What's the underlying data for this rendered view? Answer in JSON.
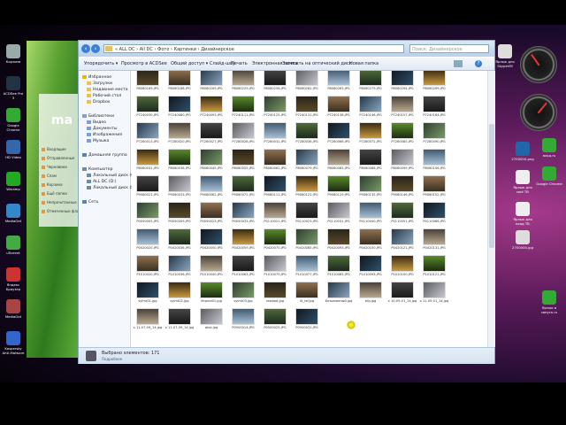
{
  "explorer": {
    "address": "« ALL DC › All DC › Фото › Картинки › Дизайнерское",
    "search_placeholder": "Поиск: Дизайнерское",
    "toolbar": [
      "Упорядочить ▾",
      "Просмотр в ACDSee",
      "Общий доступ ▾",
      "Слайд-шоу",
      "Печать",
      "Электронная почта",
      "Записать на оптический диск",
      "Новая папка"
    ],
    "nav": [
      {
        "label": "Избранное",
        "icon": "star-icon"
      },
      {
        "label": "Загрузки",
        "icon": "folder-icon"
      },
      {
        "label": "Недавние места",
        "icon": "folder-icon"
      },
      {
        "label": "Рабочий стол",
        "icon": "folder-icon"
      },
      {
        "label": "Dropbox",
        "icon": "folder-icon"
      },
      {
        "label": "Библиотеки",
        "icon": "library-icon"
      },
      {
        "label": "Видео",
        "icon": "library-icon"
      },
      {
        "label": "Документы",
        "icon": "library-icon"
      },
      {
        "label": "Изображения",
        "icon": "library-icon"
      },
      {
        "label": "Музыка",
        "icon": "library-icon"
      },
      {
        "label": "Домашняя группа",
        "icon": "network-icon"
      },
      {
        "label": "Компьютер",
        "icon": "computer-icon"
      },
      {
        "label": "Локальный диск (C:)",
        "icon": "computer-icon"
      },
      {
        "label": "ALL DC (D:)",
        "icon": "computer-icon"
      },
      {
        "label": "Локальный диск (E:)",
        "icon": "computer-icon"
      },
      {
        "label": "Сеть",
        "icon": "network-icon"
      }
    ],
    "status_text": "Выбрано элементов: 171",
    "status_sub": "Подробнее"
  },
  "thumbnails": [
    "P8080169.JPG",
    "P8080188.JPG",
    "P8080209.JPG",
    "P8080229.JPG",
    "P8080256.JPG",
    "P8080262.JPG",
    "P8080263.JPG",
    "P8080279.JPG",
    "P8080294.JPG",
    "P8080299.JPG",
    "P7240030.JPG",
    "P7240080.JPG",
    "P7240093.JPG",
    "P7240111.JPG",
    "P7240125.JPG",
    "P7240131.JPG",
    "P7240138.JPG",
    "P7240146.JPG",
    "P7240157.JPG",
    "P7240164.JPG",
    "P7280013.JPG",
    "P7280020.JPG",
    "P7280027.JPG",
    "P7280028.JPG",
    "P7280031.JPG",
    "P7280036.JPG",
    "P7280066.JPG",
    "P7280072.JPG",
    "P7280085.JPG",
    "P7280090.JPG",
    "P8080031.JPG",
    "P8080038.JPG",
    "P8080045.JPG",
    "P8080055.JPG",
    "P8080062.JPG",
    "P8080079.JPG",
    "P8080085.JPG",
    "P8080088.JPG",
    "P8080099.JPG",
    "P8080106.JPG",
    "P9080021.JPG",
    "P9080033.JPG",
    "P9080062.JPG",
    "P9080072.JPG",
    "P9080111.JPG",
    "P9080121.JPG",
    "P9080129.JPG",
    "P9080135.JPG",
    "P9080146.JPG",
    "P9080152.JPG",
    "P0050005.JPG",
    "P0050009.JPG",
    "P0050023.JPG",
    "P0050033.JPG",
    "P0110021.JPG",
    "P0110023.JPG",
    "P0110031.JPG",
    "P0110040.JPG",
    "P0110051.JPG",
    "P0110066.JPG",
    "P0420020.JPG",
    "P0420036.JPG",
    "P0420050.JPG",
    "P0420059.JPG",
    "P0420070.JPG",
    "P0420085.JPG",
    "P0420093.JPG",
    "P0420100.JPG",
    "P0420121.JPG",
    "P0420131.JPG",
    "P1010020.JPG",
    "P1010036.JPG",
    "P1010040.JPG",
    "P1010063.JPG",
    "P1010070.JPG",
    "P1010077.JPG",
    "P1010085.JPG",
    "P1010093.JPG",
    "P1010100.JPG",
    "P1010121.JPG",
    "sylmt01.jpg",
    "sylmt02.jpg",
    "litrpool01.jpg",
    "sylmt03.jpg",
    "rawpod.jpg",
    "lit_rsf.jpg",
    "Безымянный.jpg",
    "sity.jpg",
    "x 10-09-01_14.jpg",
    "x 11-09-01_14.jpg",
    "x 11-07-09_14.jpg",
    "x 11-07-09_14.jpg",
    "qhqi.jpg",
    "P0500014.JPG",
    "P0500025.JPG",
    "P0500031.JPG"
  ],
  "desktop_left": [
    {
      "label": "Корзина",
      "icon": "recycle-bin-icon",
      "color": "#9aa"
    },
    {
      "label": "ACDSee Pro 3",
      "icon": "acdsee-icon",
      "color": "#234"
    },
    {
      "label": "Google Chrome",
      "icon": "chrome-icon",
      "color": "#3a3"
    },
    {
      "label": "HD Video",
      "icon": "video-icon",
      "color": "#36a"
    },
    {
      "label": "Winamp",
      "icon": "music-icon",
      "color": "#2a2"
    },
    {
      "label": "MediaGet",
      "icon": "mediaget-icon",
      "color": "#38c"
    },
    {
      "label": "uTorrent",
      "icon": "utorrent-icon",
      "color": "#4a4"
    },
    {
      "label": "Яндекс Браузер",
      "icon": "browser-icon",
      "color": "#c33"
    },
    {
      "label": "MediaGet",
      "icon": "mediaget-icon",
      "color": "#a44"
    },
    {
      "label": "Kaspersky Anti-Malware",
      "icon": "shield-icon",
      "color": "#36c"
    }
  ],
  "desktop_right": [
    {
      "label": "Ярлык для SkypeVM",
      "icon": "shortcut-icon",
      "color": "#ddd"
    },
    {
      "label": "2700000.png",
      "icon": "image-file-icon",
      "color": "#26a"
    },
    {
      "label": "вход.ru",
      "icon": "chrome-icon",
      "color": "#3a3"
    },
    {
      "label": "Ярлык для моё ТВ",
      "icon": "shortcut-icon",
      "color": "#eee"
    },
    {
      "label": "Google Chrome",
      "icon": "chrome-icon",
      "color": "#3a3"
    },
    {
      "label": "Ярлык для вход ТВ",
      "icon": "shortcut-icon",
      "color": "#eee"
    },
    {
      "label": "2700000.jpg",
      "icon": "image-file-icon",
      "color": "#ddd"
    },
    {
      "label": "Ярлык в запуск.ru",
      "icon": "chrome-icon",
      "color": "#3a3"
    }
  ],
  "bg_window": {
    "brand": "ma",
    "items": [
      "Входящие",
      "Отправленные",
      "Черновики",
      "Спам",
      "Корзина",
      "Ещё папки",
      "Непрочитанные",
      "Отмеченные флажком"
    ]
  }
}
